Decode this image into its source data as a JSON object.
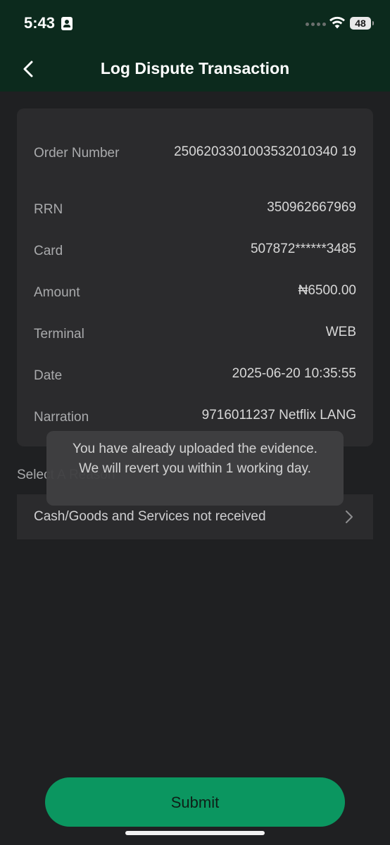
{
  "status_bar": {
    "time": "5:43",
    "battery": "48"
  },
  "header": {
    "title": "Log Dispute Transaction",
    "back_icon": "chevron-left-icon"
  },
  "details": {
    "order_number": {
      "label": "Order Number",
      "value": "2506203301003532010340 19"
    },
    "rrn": {
      "label": "RRN",
      "value": "350962667969"
    },
    "card": {
      "label": "Card",
      "value": "507872******3485"
    },
    "amount": {
      "label": "Amount",
      "value": "₦6500.00"
    },
    "terminal": {
      "label": "Terminal",
      "value": "WEB"
    },
    "date": {
      "label": "Date",
      "value": "2025-06-20 10:35:55"
    },
    "narration": {
      "label": "Narration",
      "value": "9716011237 Netflix LANG"
    }
  },
  "reason": {
    "label": "Select A Reason",
    "selected": "Cash/Goods and Services not received",
    "icon": "chevron-right-icon"
  },
  "toast": {
    "message": "You have already uploaded the evidence. We will revert you within 1 working day."
  },
  "submit": {
    "label": "Submit"
  },
  "colors": {
    "header_bg": "#0c2a1d",
    "page_bg": "#1f2022",
    "card_bg": "#2b2b2d",
    "accent": "#0b9660"
  }
}
